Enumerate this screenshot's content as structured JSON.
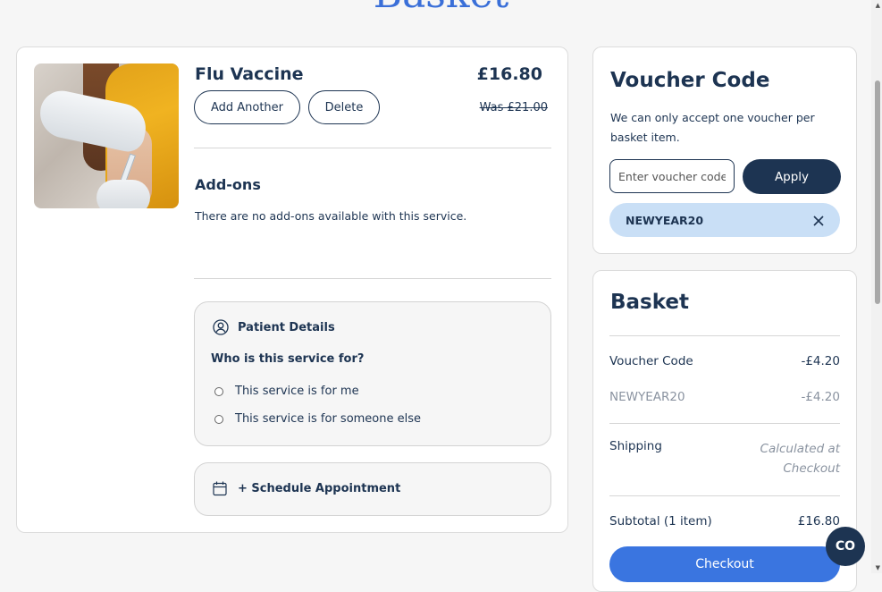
{
  "page": {
    "heading": "Basket"
  },
  "item": {
    "name": "Flu Vaccine",
    "price": "£16.80",
    "was_price": "Was £21.00",
    "add_another_label": "Add Another",
    "delete_label": "Delete",
    "addons_title": "Add-ons",
    "addons_text": "There are no add-ons available with this service.",
    "patient_details": {
      "title": "Patient Details",
      "question": "Who is this service for?",
      "options": [
        "This service is for me",
        "This service is for someone else"
      ]
    },
    "schedule_label": "+ Schedule Appointment"
  },
  "voucher": {
    "title": "Voucher Code",
    "description": "We can only accept one voucher per basket item.",
    "input_placeholder": "Enter voucher code",
    "apply_label": "Apply",
    "applied_code": "NEWYEAR20"
  },
  "basket": {
    "title": "Basket",
    "rows": [
      {
        "label": "Voucher Code",
        "value": "-£4.20"
      },
      {
        "label": "NEWYEAR20",
        "value": "-£4.20"
      },
      {
        "label": "Shipping",
        "value_line1": "Calculated at",
        "value_line2": "Checkout"
      },
      {
        "label": "Subtotal (1 item)",
        "value": "£16.80"
      }
    ],
    "checkout_label": "Checkout"
  },
  "chat": {
    "label": "CO"
  },
  "icons": {
    "user": "user-circle-icon",
    "calendar": "calendar-icon",
    "close": "close-icon"
  },
  "colors": {
    "navy": "#1d3452",
    "accent_blue": "#3a75e0",
    "chip_bg": "#c9dff6"
  }
}
